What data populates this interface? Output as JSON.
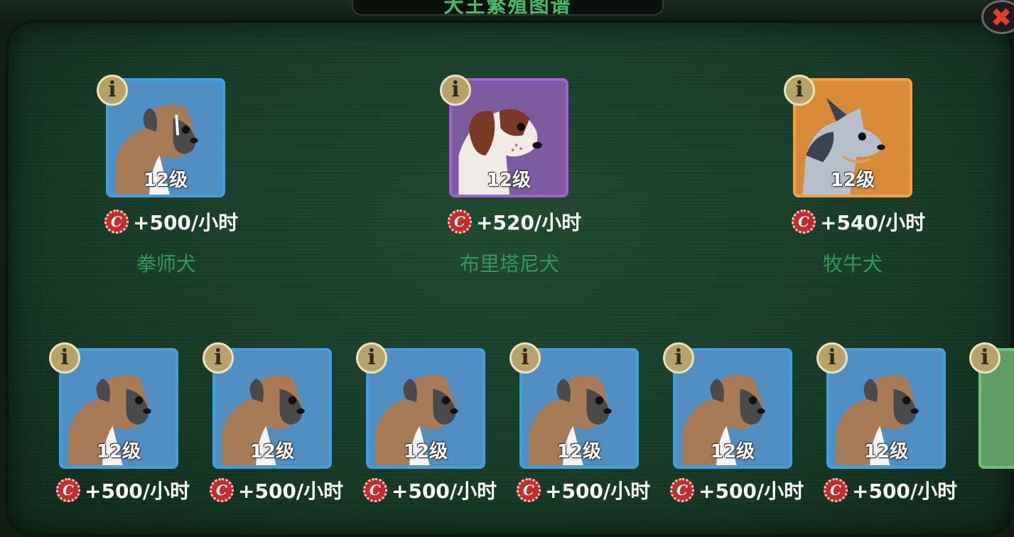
{
  "header": {
    "title": "犬王繁殖图谱"
  },
  "featured": [
    {
      "name": "拳师犬",
      "level": "12级",
      "rate": "+500/小时",
      "rarity": "blue"
    },
    {
      "name": "布里塔尼犬",
      "level": "12级",
      "rate": "+520/小时",
      "rarity": "purple"
    },
    {
      "name": "牧牛犬",
      "level": "12级",
      "rate": "+540/小时",
      "rarity": "orange"
    }
  ],
  "list": [
    {
      "level": "12级",
      "rate": "+500/小时"
    },
    {
      "level": "12级",
      "rate": "+500/小时"
    },
    {
      "level": "12级",
      "rate": "+500/小时"
    },
    {
      "level": "12级",
      "rate": "+500/小时"
    },
    {
      "level": "12级",
      "rate": "+500/小时"
    },
    {
      "level": "12级",
      "rate": "+500/小时"
    }
  ],
  "icons": {
    "info": "info-icon",
    "cap": "bottle-cap-icon",
    "close": "close-icon"
  },
  "colors": {
    "blue": "#4f8fc2",
    "purple": "#7e5aa0",
    "orange": "#d98a36",
    "name_green": "#2f9a5c"
  }
}
